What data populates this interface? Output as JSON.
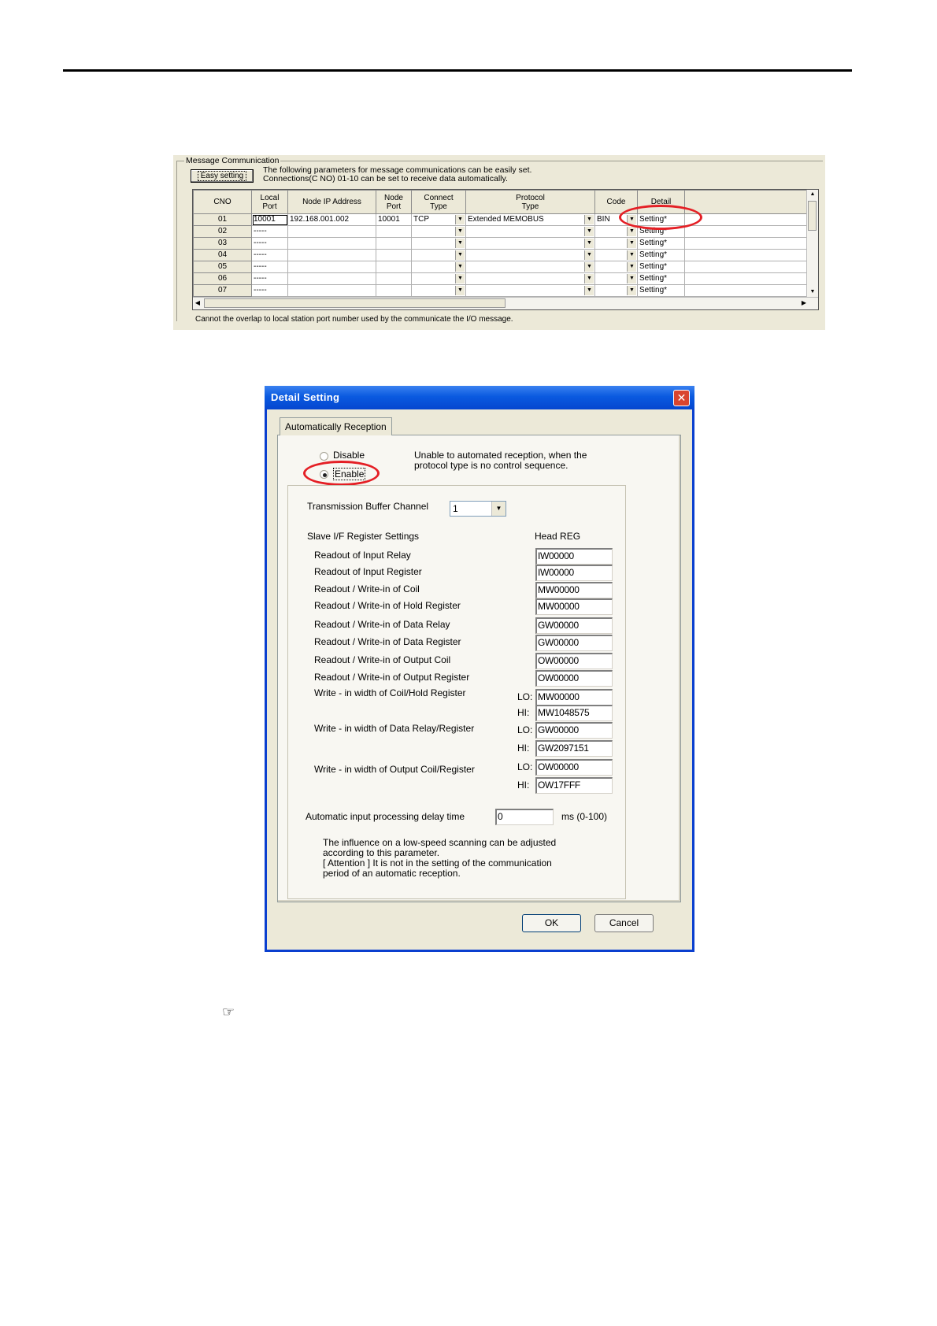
{
  "message_communication": {
    "legend": "Message Communication",
    "easy_setting_button": "Easy setting",
    "description_line1": "The following parameters for message communications can be easily set.",
    "description_line2": "Connections(C NO) 01-10 can be set to receive data automatically.",
    "columns": [
      "CNO",
      "Local Port",
      "Node IP Address",
      "Node Port",
      "Connect Type",
      "Protocol Type",
      "Code",
      "Detail"
    ],
    "rows": [
      {
        "cno": "01",
        "local_port": "10001",
        "node_ip": "192.168.001.002",
        "node_port": "10001",
        "connect_type": "TCP",
        "protocol_type": "Extended MEMOBUS",
        "code": "BIN",
        "detail": "Setting*"
      },
      {
        "cno": "02",
        "local_port": "-----",
        "node_ip": "",
        "node_port": "",
        "connect_type": "",
        "protocol_type": "",
        "code": "",
        "detail": "Setting*"
      },
      {
        "cno": "03",
        "local_port": "-----",
        "node_ip": "",
        "node_port": "",
        "connect_type": "",
        "protocol_type": "",
        "code": "",
        "detail": "Setting*"
      },
      {
        "cno": "04",
        "local_port": "-----",
        "node_ip": "",
        "node_port": "",
        "connect_type": "",
        "protocol_type": "",
        "code": "",
        "detail": "Setting*"
      },
      {
        "cno": "05",
        "local_port": "-----",
        "node_ip": "",
        "node_port": "",
        "connect_type": "",
        "protocol_type": "",
        "code": "",
        "detail": "Setting*"
      },
      {
        "cno": "06",
        "local_port": "-----",
        "node_ip": "",
        "node_port": "",
        "connect_type": "",
        "protocol_type": "",
        "code": "",
        "detail": "Setting*"
      },
      {
        "cno": "07",
        "local_port": "-----",
        "node_ip": "",
        "node_port": "",
        "connect_type": "",
        "protocol_type": "",
        "code": "",
        "detail": "Setting*"
      }
    ],
    "footer_note": "Cannot the overlap to local station port number used by the communicate the  I/O message."
  },
  "detail_dialog": {
    "title": "Detail Setting",
    "tab": "Automatically Reception",
    "disable_label": "Disable",
    "enable_label": "Enable",
    "selected": "Enable",
    "info_line1": "Unable to automated reception, when the",
    "info_line2": "protocol type is no control sequence.",
    "buffer_channel_label": "Transmission Buffer Channel",
    "buffer_channel_value": "1",
    "slave_header": "Slave I/F Register Settings",
    "head_reg_header": "Head REG",
    "registers": [
      {
        "label": "Readout of Input Relay",
        "value": "IW00000"
      },
      {
        "label": "Readout of Input Register",
        "value": "IW00000"
      },
      {
        "label": "Readout / Write-in of Coil",
        "value": "MW00000"
      },
      {
        "label": "Readout / Write-in of Hold Register",
        "value": "MW00000"
      },
      {
        "label": "Readout / Write-in of Data Relay",
        "value": "GW00000"
      },
      {
        "label": "Readout / Write-in of Data Register",
        "value": "GW00000"
      },
      {
        "label": "Readout / Write-in of Output Coil",
        "value": "OW00000"
      },
      {
        "label": "Readout / Write-in of Output Register",
        "value": "OW00000"
      }
    ],
    "widths": [
      {
        "label": "Write - in width of Coil/Hold Register",
        "lo": "MW00000",
        "hi": "MW1048575"
      },
      {
        "label": "Write - in width of Data Relay/Register",
        "lo": "GW00000",
        "hi": "GW2097151"
      },
      {
        "label": "Write - in width of Output Coil/Register",
        "lo": "OW00000",
        "hi": "OW17FFF"
      }
    ],
    "lo_label": "LO:",
    "hi_label": "HI:",
    "delay_label": "Automatic input processing delay time",
    "delay_value": "0",
    "delay_unit": "ms (0-100)",
    "note_line1": "The influence on a low-speed scanning can be adjusted",
    "note_line2": "according to this parameter.",
    "note_line3": "[ Attention ] It is not in the setting of the communication",
    "note_line4": "period of an automatic reception.",
    "ok_button": "OK",
    "cancel_button": "Cancel",
    "close_glyph": "✕"
  },
  "annotation_color": "#e41f25",
  "note_icon": "pointing-hand-icon",
  "note_glyph": "☞"
}
